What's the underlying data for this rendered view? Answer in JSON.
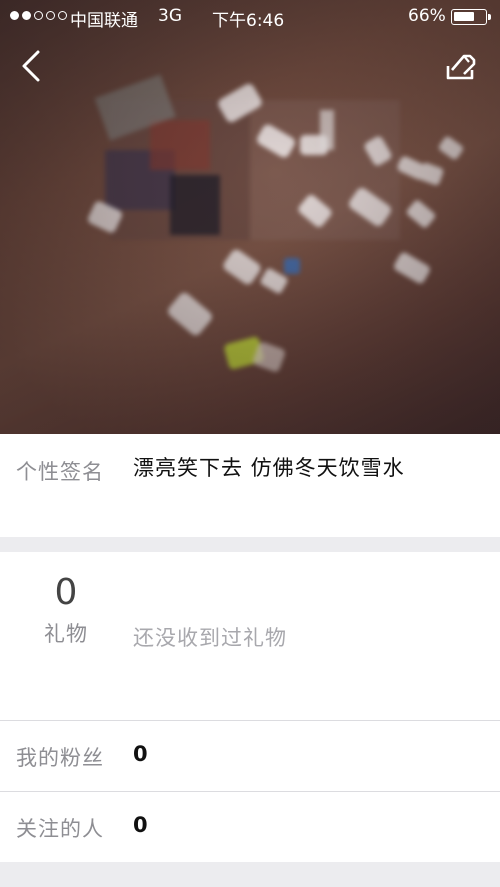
{
  "status_bar": {
    "carrier": "中国联通",
    "network": "3G",
    "time": "下午6:46",
    "battery": "66%",
    "battery_level": 0.66,
    "signal_filled": 2,
    "signal_total": 5
  },
  "nav": {
    "back_icon": "chevron-left-icon",
    "edit_icon": "edit-icon"
  },
  "profile": {
    "signature_label": "个性签名",
    "signature_text": "漂亮笑下去 仿佛冬天饮雪水"
  },
  "gifts": {
    "count": "0",
    "label": "礼物",
    "empty_text": "还没收到过礼物"
  },
  "stats": {
    "fans_label": "我的粉丝",
    "fans_value": "0",
    "following_label": "关注的人",
    "following_value": "0"
  },
  "colors": {
    "accent_label": "#8e8e93",
    "background": "#ececef"
  }
}
